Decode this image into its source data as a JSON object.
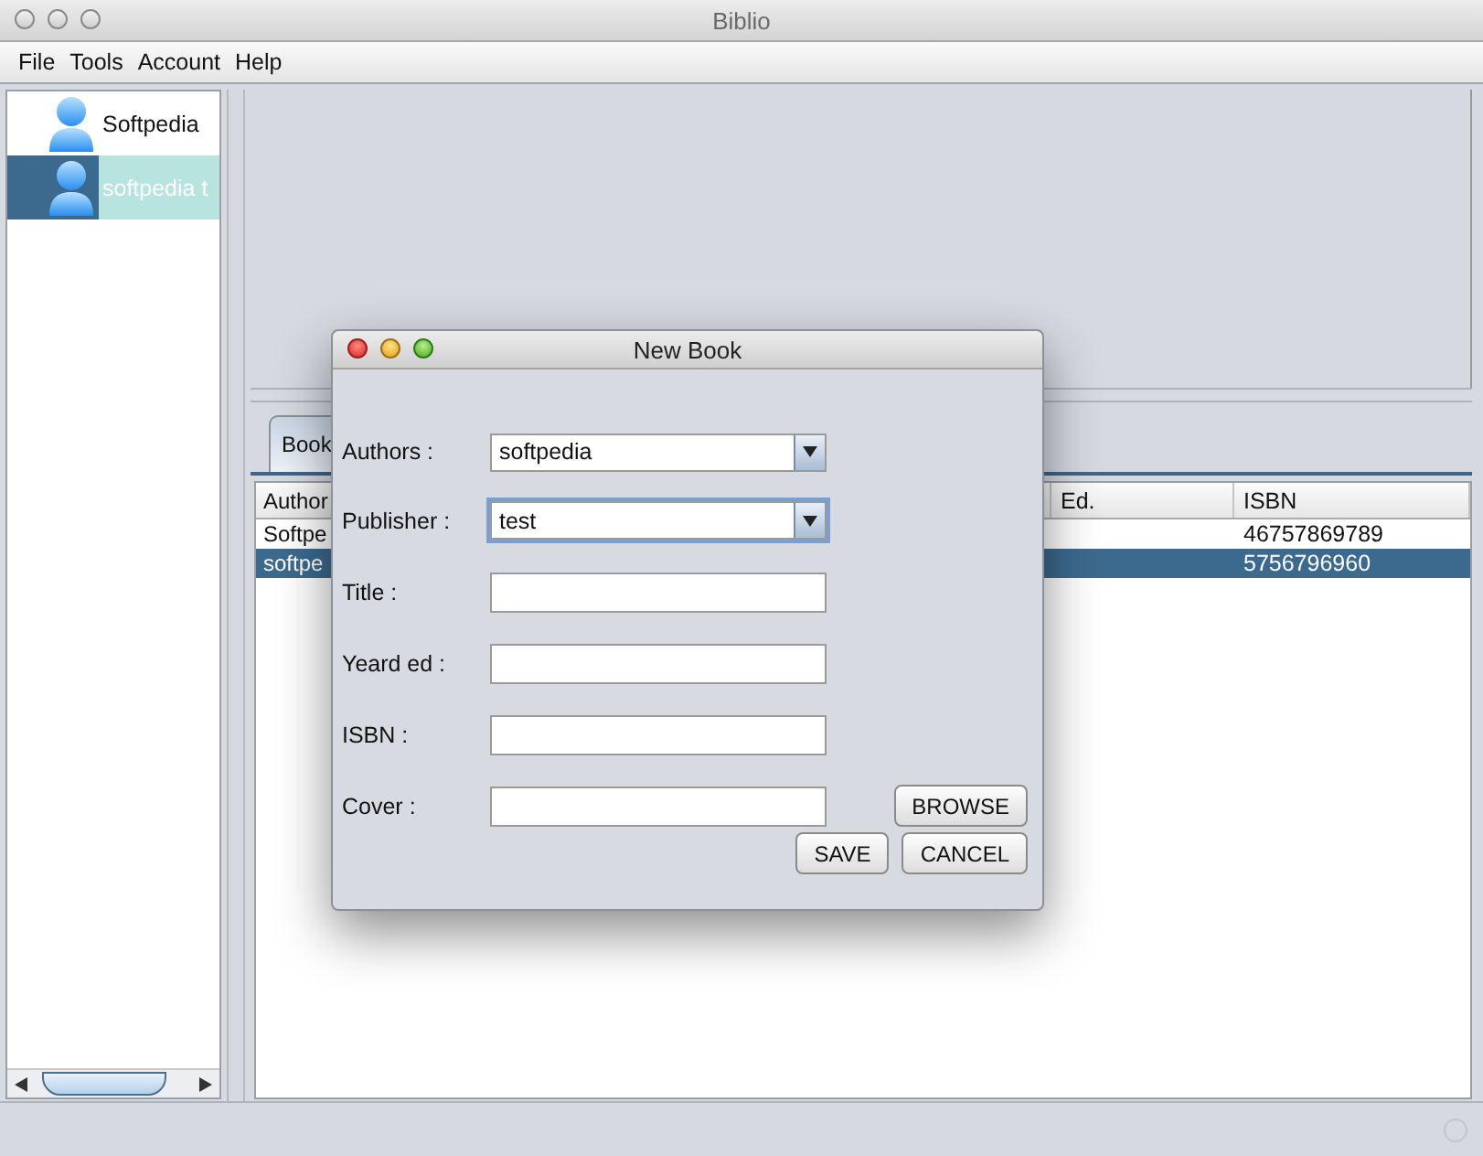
{
  "window": {
    "title": "Biblio"
  },
  "menu": [
    "File",
    "Tools",
    "Account",
    "Help"
  ],
  "accounts": [
    {
      "name": "Softpedia",
      "selected": false
    },
    {
      "name": "softpedia t",
      "selected": true
    }
  ],
  "tabs": [
    {
      "label": "Book",
      "selected": true
    }
  ],
  "table": {
    "columns": [
      "Author",
      "Ed.",
      "ISBN"
    ],
    "rows": [
      {
        "author": "Softpe",
        "isbn": "46757869789",
        "selected": false
      },
      {
        "author": "softpe",
        "isbn": "5756796960",
        "selected": true
      }
    ]
  },
  "dialog": {
    "title": "New Book",
    "fields": [
      {
        "label": "Authors :",
        "kind": "combo",
        "value": "softpedia",
        "focused": false
      },
      {
        "label": "Publisher :",
        "kind": "combo",
        "value": "test",
        "focused": true
      },
      {
        "label": "Title :",
        "kind": "text"
      },
      {
        "label": "Yeard ed :",
        "kind": "text"
      },
      {
        "label": "ISBN :",
        "kind": "text"
      },
      {
        "label": "Cover :",
        "kind": "text",
        "button": "BROWSE"
      }
    ],
    "buttons": [
      "SAVE",
      "CANCEL"
    ]
  }
}
